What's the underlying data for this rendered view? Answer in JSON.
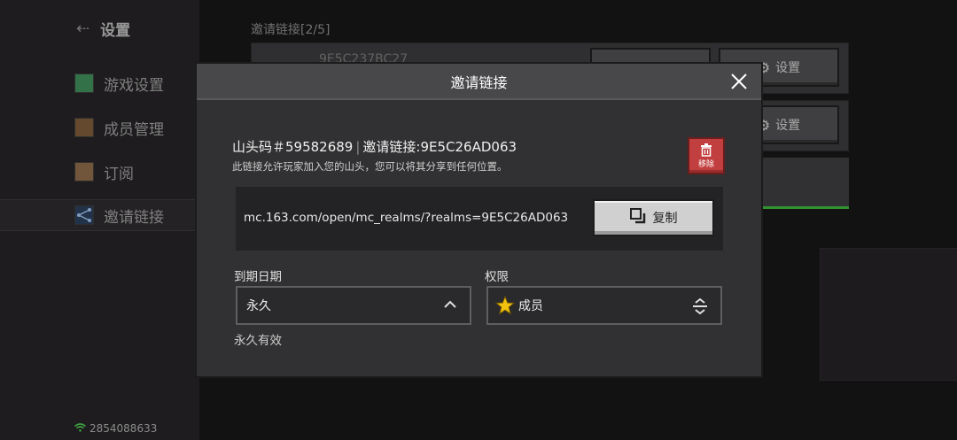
{
  "sidebar": {
    "title": "设置",
    "items": [
      {
        "label": "游戏设置",
        "icon": "grass-block-icon"
      },
      {
        "label": "成员管理",
        "icon": "player-head-icon"
      },
      {
        "label": "订阅",
        "icon": "calendar-icon"
      },
      {
        "label": "邀请链接",
        "icon": "share-icon",
        "active": true
      }
    ],
    "status_id": "2854088633"
  },
  "background": {
    "list_title": "邀请链接[2/5]",
    "rows": [
      {
        "code": "9E5C237BC27",
        "button": "设置"
      },
      {
        "code": "",
        "button": "设置"
      }
    ]
  },
  "dialog": {
    "title": "邀请链接",
    "code_label": "山头码＃59582689",
    "link_label": "邀请链接:9E5C26AD063",
    "description": "此链接允许玩家加入您的山头，您可以将其分享到任何位置。",
    "remove_label": "移除",
    "url": "mc.163.com/open/mc_realms/?realms=9E5C26AD063",
    "copy_label": "复制",
    "expiry": {
      "label": "到期日期",
      "value": "永久",
      "note": "永久有效"
    },
    "permission": {
      "label": "权限",
      "value": "成员"
    }
  },
  "colors": {
    "remove_red": "#c23f3f",
    "active_green": "#3bb33b",
    "star_yellow": "#f2c20e"
  }
}
